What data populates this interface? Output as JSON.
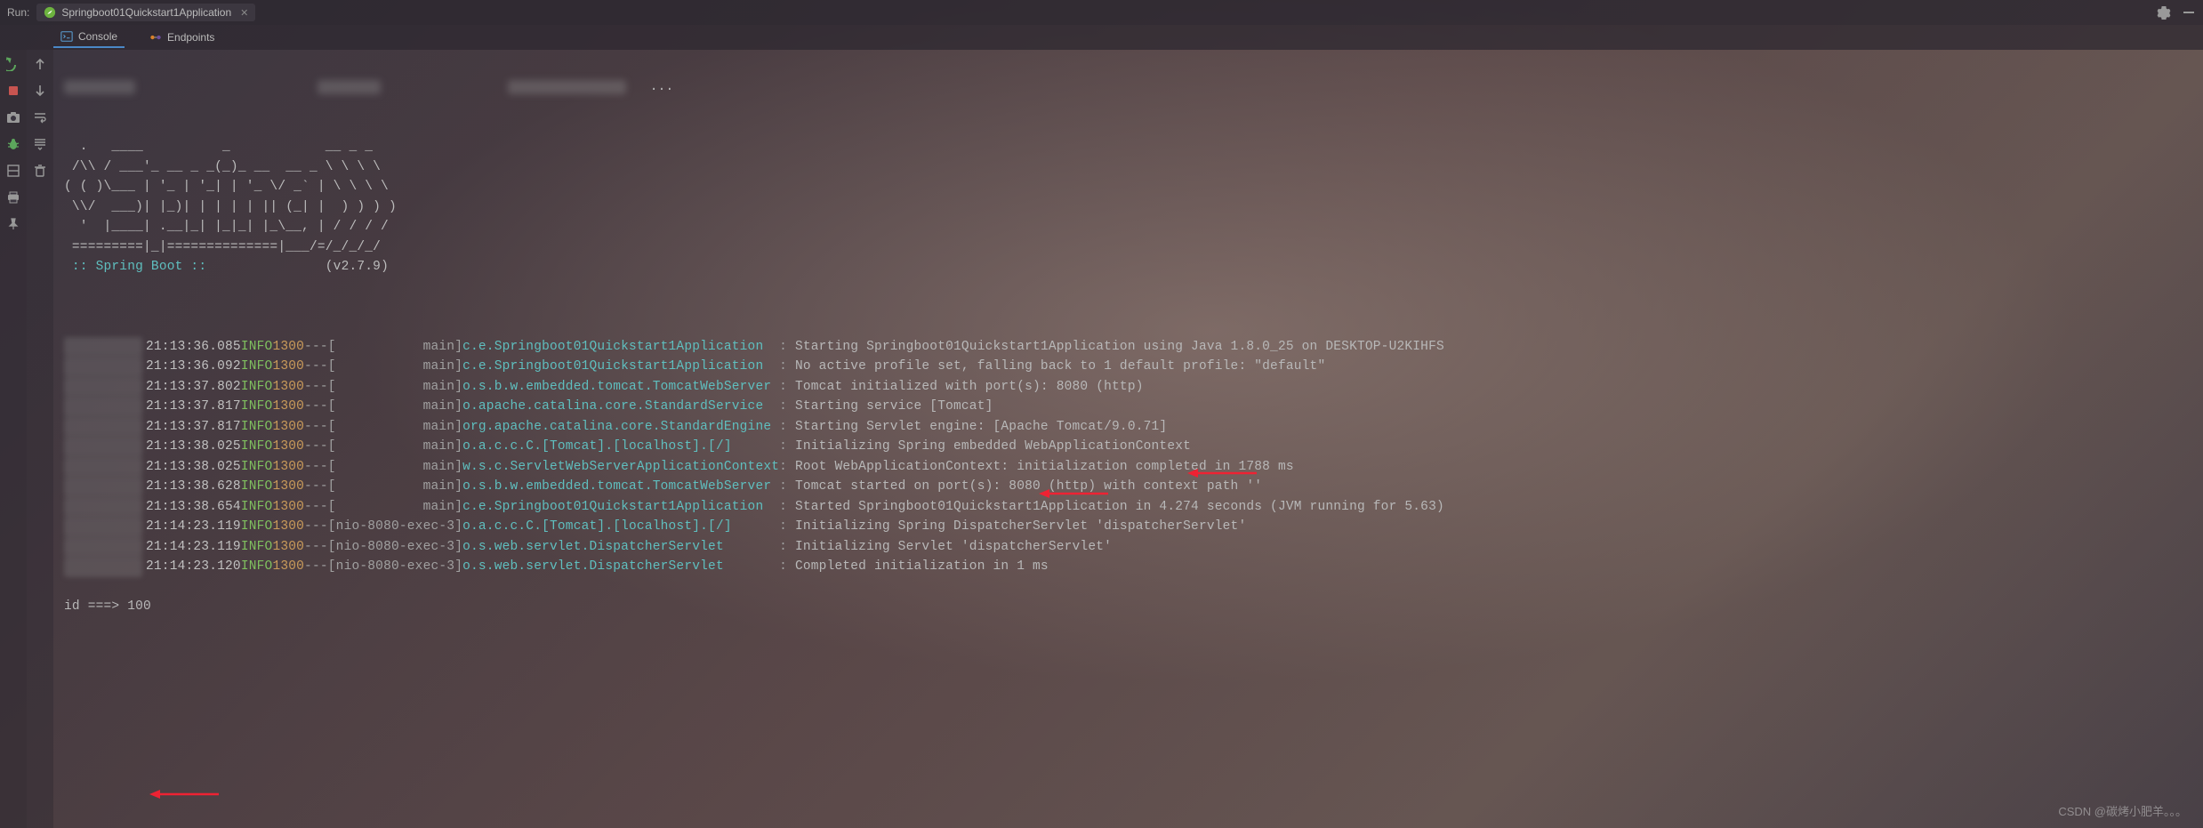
{
  "header": {
    "run_label": "Run:",
    "config_name": "Springboot01Quickstart1Application"
  },
  "tabs": {
    "console": "Console",
    "endpoints": "Endpoints"
  },
  "banner": {
    "lines": [
      "  .   ____          _            __ _ _",
      " /\\\\ / ___'_ __ _ _(_)_ __  __ _ \\ \\ \\ \\",
      "( ( )\\___ | '_ | '_| | '_ \\/ _` | \\ \\ \\ \\",
      " \\\\/  ___)| |_)| | | | | || (_| |  ) ) ) )",
      "  '  |____| .__|_| |_|_| |_\\__, | / / / /",
      " =========|_|==============|___/=/_/_/_/"
    ],
    "tag": " :: Spring Boot ::",
    "version": "(v2.7.9)"
  },
  "logs": [
    {
      "time": "21:13:36.085",
      "level": "INFO",
      "pid": "1300",
      "thread": "[           main]",
      "logger": "c.e.Springboot01Quickstart1Application  ",
      "msg": "Starting Springboot01Quickstart1Application using Java 1.8.0_25 on DESKTOP-U2KIHFS"
    },
    {
      "time": "21:13:36.092",
      "level": "INFO",
      "pid": "1300",
      "thread": "[           main]",
      "logger": "c.e.Springboot01Quickstart1Application  ",
      "msg": "No active profile set, falling back to 1 default profile: \"default\""
    },
    {
      "time": "21:13:37.802",
      "level": "INFO",
      "pid": "1300",
      "thread": "[           main]",
      "logger": "o.s.b.w.embedded.tomcat.TomcatWebServer ",
      "msg": "Tomcat initialized with port(s): 8080 (http)"
    },
    {
      "time": "21:13:37.817",
      "level": "INFO",
      "pid": "1300",
      "thread": "[           main]",
      "logger": "o.apache.catalina.core.StandardService  ",
      "msg": "Starting service [Tomcat]"
    },
    {
      "time": "21:13:37.817",
      "level": "INFO",
      "pid": "1300",
      "thread": "[           main]",
      "logger": "org.apache.catalina.core.StandardEngine ",
      "msg": "Starting Servlet engine: [Apache Tomcat/9.0.71]"
    },
    {
      "time": "21:13:38.025",
      "level": "INFO",
      "pid": "1300",
      "thread": "[           main]",
      "logger": "o.a.c.c.C.[Tomcat].[localhost].[/]      ",
      "msg": "Initializing Spring embedded WebApplicationContext"
    },
    {
      "time": "21:13:38.025",
      "level": "INFO",
      "pid": "1300",
      "thread": "[           main]",
      "logger": "w.s.c.ServletWebServerApplicationContext",
      "msg": "Root WebApplicationContext: initialization completed in 1788 ms"
    },
    {
      "time": "21:13:38.628",
      "level": "INFO",
      "pid": "1300",
      "thread": "[           main]",
      "logger": "o.s.b.w.embedded.tomcat.TomcatWebServer ",
      "msg": "Tomcat started on port(s): 8080 (http) with context path ''"
    },
    {
      "time": "21:13:38.654",
      "level": "INFO",
      "pid": "1300",
      "thread": "[           main]",
      "logger": "c.e.Springboot01Quickstart1Application  ",
      "msg": "Started Springboot01Quickstart1Application in 4.274 seconds (JVM running for 5.63)"
    },
    {
      "time": "21:14:23.119",
      "level": "INFO",
      "pid": "1300",
      "thread": "[nio-8080-exec-3]",
      "logger": "o.a.c.c.C.[Tomcat].[localhost].[/]      ",
      "msg": "Initializing Spring DispatcherServlet 'dispatcherServlet'"
    },
    {
      "time": "21:14:23.119",
      "level": "INFO",
      "pid": "1300",
      "thread": "[nio-8080-exec-3]",
      "logger": "o.s.web.servlet.DispatcherServlet       ",
      "msg": "Initializing Servlet 'dispatcherServlet'"
    },
    {
      "time": "21:14:23.120",
      "level": "INFO",
      "pid": "1300",
      "thread": "[nio-8080-exec-3]",
      "logger": "o.s.web.servlet.DispatcherServlet       ",
      "msg": "Completed initialization in 1 ms"
    }
  ],
  "output": "id ===> 100",
  "watermark": "CSDN @碳烤小肥羊。。。"
}
